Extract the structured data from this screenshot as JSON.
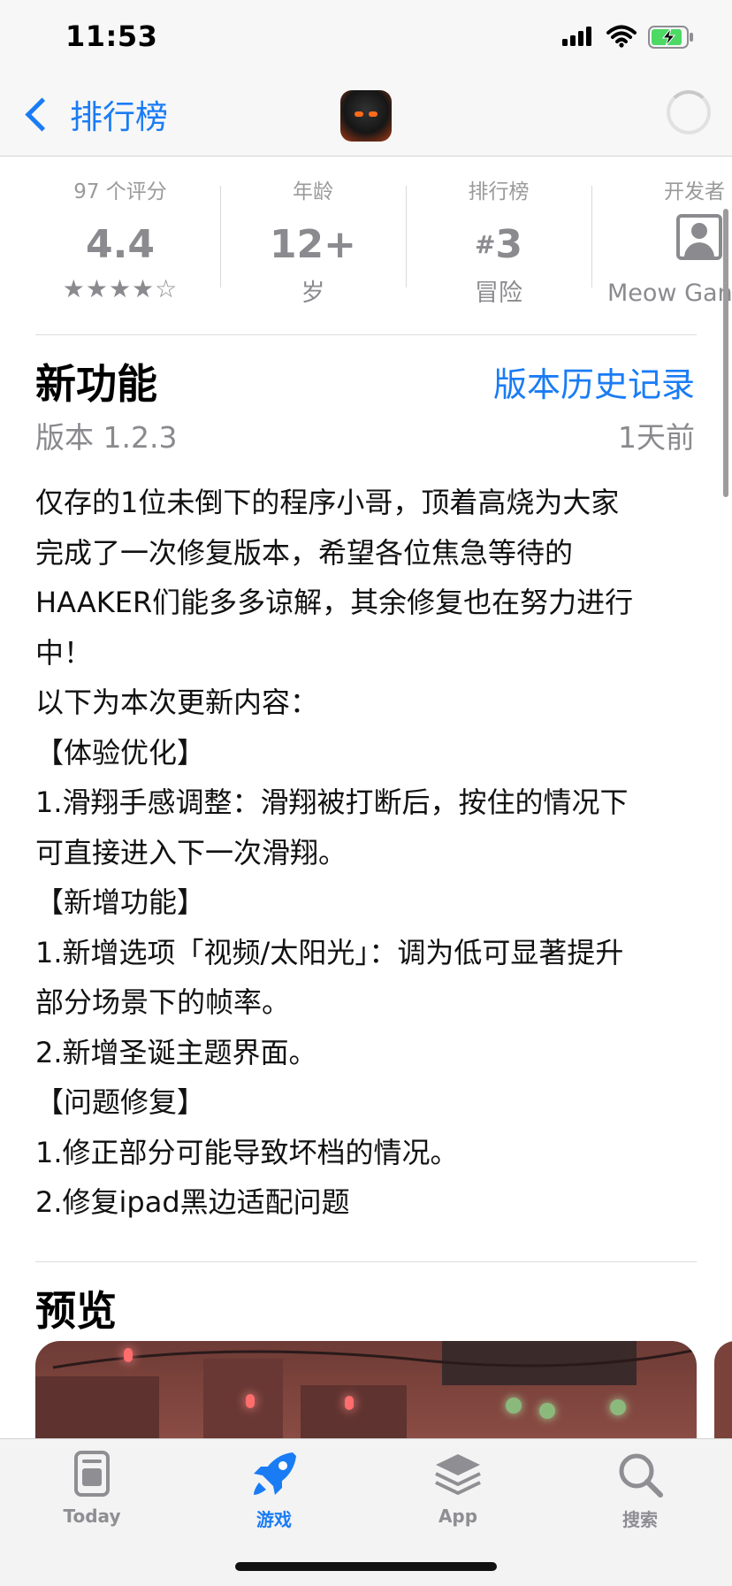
{
  "status_bar": {
    "time": "11:53"
  },
  "nav": {
    "back_label": "排行榜"
  },
  "info": {
    "ratings": {
      "header": "97 个评分",
      "value": "4.4",
      "stars": "★★★★☆"
    },
    "age": {
      "header": "年龄",
      "value": "12+",
      "sub": "岁"
    },
    "rank": {
      "header": "排行榜",
      "hash": "#",
      "value": "3",
      "sub": "冒险"
    },
    "developer": {
      "header": "开发者",
      "sub": "Meow Gan"
    }
  },
  "whats_new": {
    "title": "新功能",
    "history_link": "版本历史记录",
    "version": "版本 1.2.3",
    "date": "1天前",
    "lines": [
      "仅存的1位未倒下的程序小哥，顶着高烧为大家",
      "完成了一次修复版本，希望各位焦急等待的",
      "HAAKER们能多多谅解，其余修复也在努力进行",
      "中！",
      "以下为本次更新内容：",
      "【体验优化】",
      "1.滑翔手感调整：滑翔被打断后，按住的情况下",
      "可直接进入下一次滑翔。",
      "【新增功能】",
      "1.新增选项「视频/太阳光」：调为低可显著提升",
      "部分场景下的帧率。",
      "2.新增圣诞主题界面。",
      "【问题修复】",
      "1.修正部分可能导致坏档的情况。",
      "2.修复ipad黑边适配问题"
    ]
  },
  "preview": {
    "title": "预览"
  },
  "tabs": [
    {
      "label": "Today",
      "icon": "today-icon",
      "active": false
    },
    {
      "label": "游戏",
      "icon": "rocket-icon",
      "active": true
    },
    {
      "label": "App",
      "icon": "app-stack-icon",
      "active": false
    },
    {
      "label": "搜索",
      "icon": "search-icon",
      "active": false
    }
  ],
  "colors": {
    "accent": "#1a7cf5",
    "secondary_text": "#8a8a8e",
    "battery_charging": "#4cd964"
  }
}
